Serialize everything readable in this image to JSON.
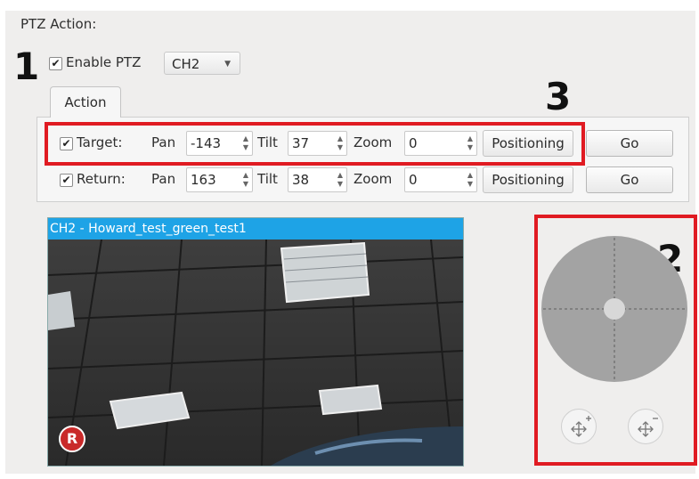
{
  "section_title": "PTZ Action:",
  "callouts": [
    "1",
    "2",
    "3"
  ],
  "enable_ptz": {
    "label": "Enable PTZ",
    "checked": true
  },
  "channel_select": {
    "value": "CH2"
  },
  "tabs": [
    {
      "label": "Action"
    }
  ],
  "target_row": {
    "checked": true,
    "label": "Target:",
    "pan_label": "Pan",
    "pan_value": "-143",
    "tilt_label": "Tilt",
    "tilt_value": "37",
    "zoom_label": "Zoom",
    "zoom_value": "0",
    "positioning_label": "Positioning",
    "go_label": "Go"
  },
  "return_row": {
    "checked": true,
    "label": "Return:",
    "pan_label": "Pan",
    "pan_value": "163",
    "tilt_label": "Tilt",
    "tilt_value": "38",
    "zoom_label": "Zoom",
    "zoom_value": "0",
    "positioning_label": "Positioning",
    "go_label": "Go"
  },
  "video": {
    "title": "CH2 - Howard_test_green_test1",
    "record_badge": "R"
  },
  "ptz_controls": {
    "zoom_in_icon": "zoom-in-icon",
    "zoom_out_icon": "zoom-out-icon"
  },
  "colors": {
    "highlight_red": "#e01b22",
    "video_title_bg": "#1ea3e6",
    "panel_bg": "#efeeed"
  }
}
